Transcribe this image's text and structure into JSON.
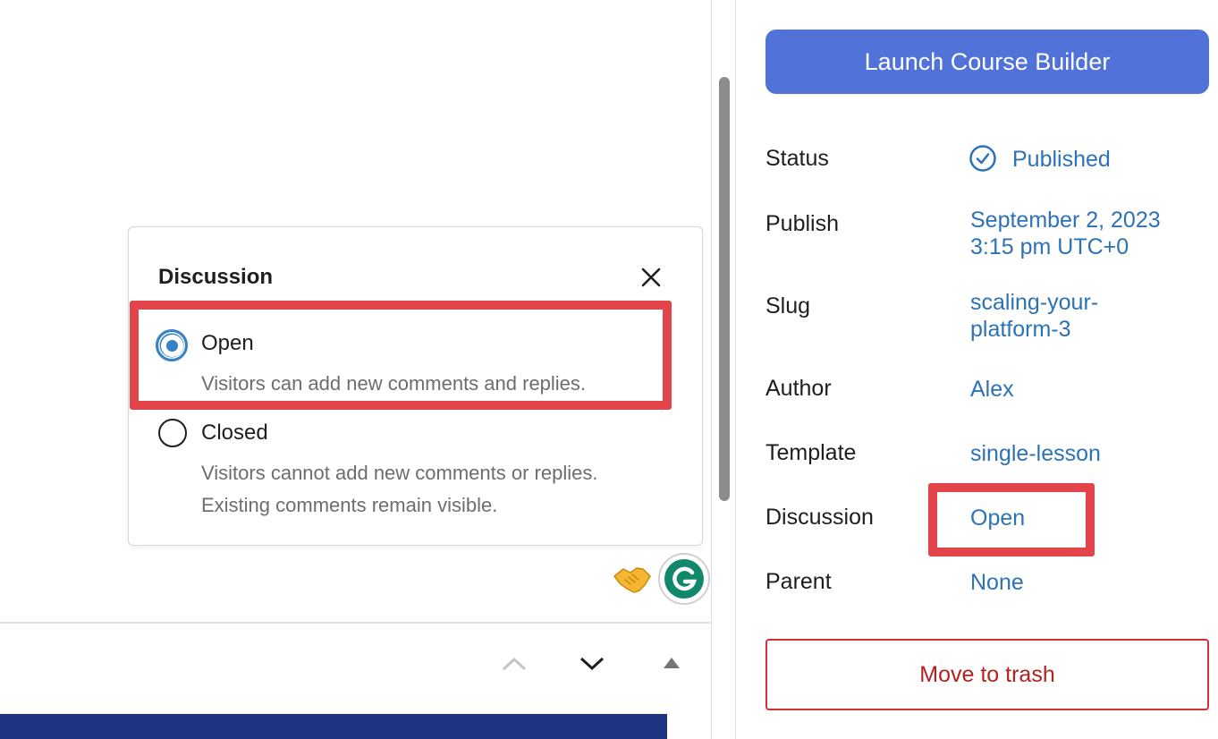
{
  "popover": {
    "title": "Discussion",
    "options": [
      {
        "label": "Open",
        "description": [
          "Visitors can add new comments and replies."
        ],
        "checked": true
      },
      {
        "label": "Closed",
        "description": [
          "Visitors cannot add new comments or replies.",
          "Existing comments remain visible."
        ],
        "checked": false
      }
    ]
  },
  "sidebar": {
    "launch_button": "Launch Course Builder",
    "rows": {
      "status": {
        "label": "Status",
        "value": "Published"
      },
      "publish": {
        "label": "Publish",
        "value_lines": [
          "September 2, 2023",
          "3:15 pm UTC+0"
        ]
      },
      "slug": {
        "label": "Slug",
        "value_lines": [
          "scaling-your-",
          "platform-3"
        ]
      },
      "author": {
        "label": "Author",
        "value": "Alex"
      },
      "template": {
        "label": "Template",
        "value": "single-lesson"
      },
      "discussion": {
        "label": "Discussion",
        "value": "Open"
      },
      "parent": {
        "label": "Parent",
        "value": "None"
      }
    },
    "trash_button": "Move to trash"
  },
  "colors": {
    "accent": "#3582c4",
    "link": "#2c72b6",
    "launch_button_bg": "#5172d8",
    "highlight": "#e3444a",
    "trash": "#b32222",
    "grammarly": "#11876b",
    "bottom_bar": "#1d3581"
  },
  "icons": {
    "close": "close-icon",
    "status": "check-circle-icon",
    "emoji": "handshake-icon",
    "grammarly": "grammarly-icon",
    "up": "chevron-up-icon",
    "down": "chevron-down-icon",
    "top": "triangle-up-icon"
  }
}
